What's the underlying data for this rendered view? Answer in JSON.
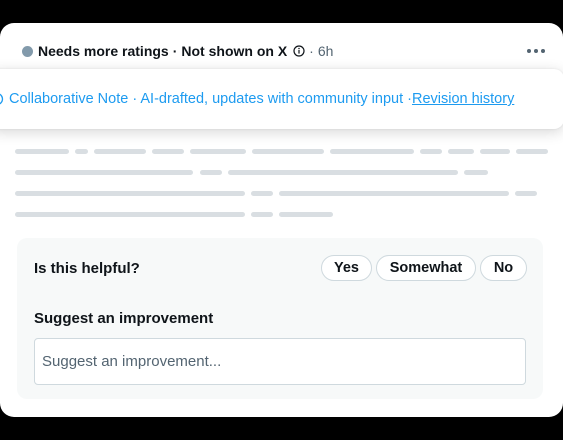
{
  "header": {
    "status": "Needs more ratings",
    "separator": "·",
    "visibility": "Not shown on X",
    "time": "6h",
    "status_dot_color": "#829aab",
    "info_icon": "info-icon",
    "more_icon": "more-horizontal-icon"
  },
  "banner": {
    "icon": "collaborative-note-icon",
    "text": "Collaborative Note · AI-drafted, updates with community input · ",
    "link": "Revision history",
    "accent_color": "#1d9bf0"
  },
  "feedback": {
    "question": "Is this helpful?",
    "options": [
      "Yes",
      "Somewhat",
      "No"
    ],
    "suggest_label": "Suggest an improvement",
    "suggest_placeholder": "Suggest an improvement..."
  }
}
